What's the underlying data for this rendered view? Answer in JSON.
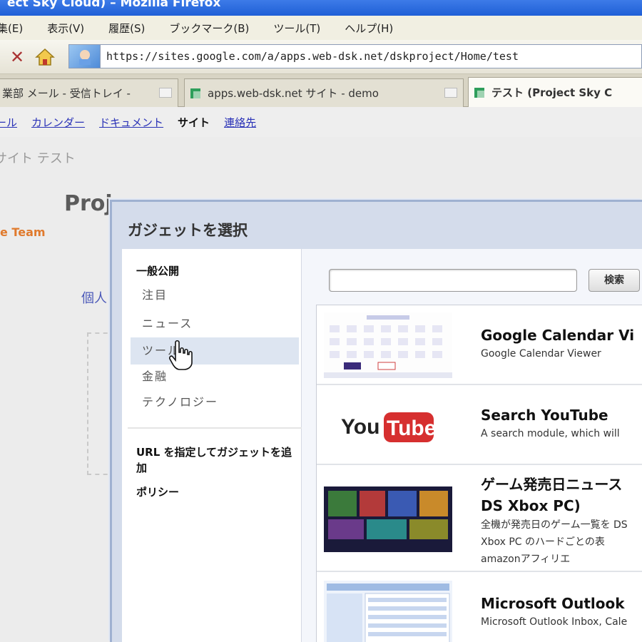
{
  "window": {
    "title": "ect Sky Cloud) – Mozilla Firefox"
  },
  "menu": {
    "items": [
      "集(E)",
      "表示(V)",
      "履歴(S)",
      "ブックマーク(B)",
      "ツール(T)",
      "ヘルプ(H)"
    ]
  },
  "address": {
    "url": "https://sites.google.com/a/apps.web-dsk.net/dskproject/Home/test"
  },
  "tabs": [
    {
      "label": "業部 メール - 受信トレイ -"
    },
    {
      "label": "apps.web-dsk.net サイト - demo"
    },
    {
      "label": "テスト (Project Sky C"
    }
  ],
  "google_nav": {
    "links": [
      "ール",
      "カレンダー",
      "ドキュメント"
    ],
    "current": "サイト",
    "last": "連絡先"
  },
  "breadcrumb": "サイト テスト",
  "page": {
    "title": "Proj",
    "team": "e Team",
    "kojin": "個人"
  },
  "dialog": {
    "title": "ガジェットを選択",
    "section_title": "一般公開",
    "categories": [
      "注目",
      "ニュース",
      "ツール",
      "金融",
      "テクノロジー"
    ],
    "url_add": "URL を指定してガジェットを追加",
    "policy": "ポリシー",
    "search": {
      "placeholder": "",
      "button_label": "検索"
    },
    "results": [
      {
        "title": "Google Calendar Vi",
        "desc": "Google Calendar Viewer"
      },
      {
        "title": "Search YouTube",
        "desc": "A search module, which will"
      },
      {
        "title": "ゲーム発売日ニュース DS Xbox PC)",
        "desc": "全機が発売日のゲーム一覧を DS Xbox PC のハードごとの表 amazonアフィリエ"
      },
      {
        "title": "Microsoft Outlook",
        "desc": "Microsoft Outlook Inbox, Cale"
      }
    ]
  },
  "colors": {
    "titlebar": "#2a6ae0",
    "link": "#2a32b7",
    "accent_orange": "#e07a2d",
    "dialog_border": "#9fb1d1"
  }
}
